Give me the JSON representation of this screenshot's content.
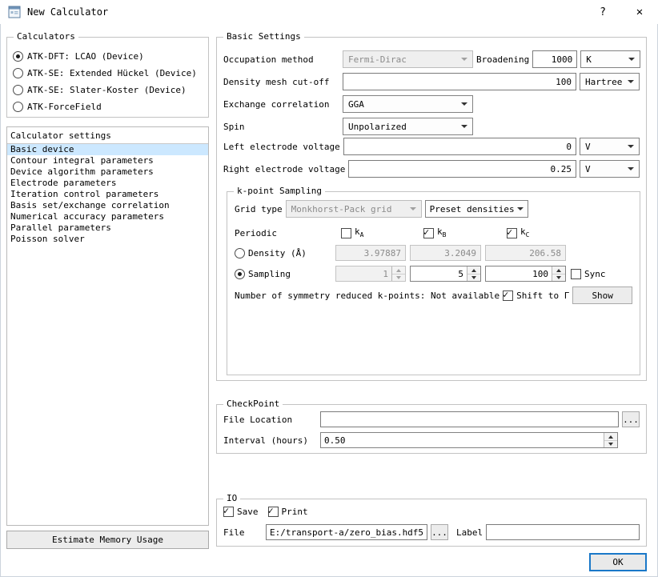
{
  "window": {
    "title": "New Calculator",
    "help": "?",
    "close": "✕"
  },
  "left": {
    "calculators": {
      "label": "Calculators",
      "options": [
        {
          "label": "ATK-DFT: LCAO (Device)",
          "selected": true
        },
        {
          "label": "ATK-SE: Extended Hückel (Device)",
          "selected": false
        },
        {
          "label": "ATK-SE: Slater-Koster (Device)",
          "selected": false
        },
        {
          "label": "ATK-ForceField",
          "selected": false
        }
      ]
    },
    "settings": {
      "header": "Calculator settings",
      "selected": "Basic device",
      "items": [
        "Basic device",
        "Contour integral parameters",
        "Device algorithm parameters",
        "Electrode parameters",
        "Iteration control parameters",
        "Basis set/exchange correlation",
        "Numerical accuracy parameters",
        "Parallel parameters",
        "Poisson solver"
      ]
    },
    "estimate_button": "Estimate Memory Usage"
  },
  "basic": {
    "label": "Basic Settings",
    "occupation_label": "Occupation method",
    "occupation_value": "Fermi-Dirac",
    "broadening_label": "Broadening",
    "broadening_value": "1000",
    "broadening_unit": "K",
    "mesh_label": "Density mesh cut-off",
    "mesh_value": "100",
    "mesh_unit": "Hartree",
    "xc_label": "Exchange correlation",
    "xc_value": "GGA",
    "spin_label": "Spin",
    "spin_value": "Unpolarized",
    "left_voltage_label": "Left electrode voltage",
    "left_voltage_value": "0",
    "left_voltage_unit": "V",
    "right_voltage_label": "Right electrode voltage",
    "right_voltage_value": "0.25",
    "right_voltage_unit": "V"
  },
  "kpoint": {
    "label": "k-point Sampling",
    "grid_type_label": "Grid type",
    "grid_type_value": "Monkhorst-Pack grid",
    "preset_button": "Preset densities",
    "periodic_label": "Periodic",
    "k": [
      {
        "base": "k",
        "sub": "A",
        "checked": false
      },
      {
        "base": "k",
        "sub": "B",
        "checked": true
      },
      {
        "base": "k",
        "sub": "C",
        "checked": true
      }
    ],
    "density_label": "Density (Å)",
    "density_selected": false,
    "density_values": [
      "3.97887",
      "3.2049",
      "206.58"
    ],
    "sampling_label": "Sampling",
    "sampling_selected": true,
    "sampling_values": [
      "1",
      "5",
      "100"
    ],
    "sync_label": "Sync",
    "sync_checked": false,
    "symmetry_text": "Number of symmetry reduced k-points: Not available",
    "shift_label": "Shift to Γ",
    "shift_checked": true,
    "show_button": "Show"
  },
  "checkpoint": {
    "label": "CheckPoint",
    "file_location_label": "File Location",
    "file_location_value": "",
    "browse_button": "...",
    "interval_label": "Interval (hours)",
    "interval_value": "0.50"
  },
  "io": {
    "label": "IO",
    "save_label": "Save",
    "save_checked": true,
    "print_label": "Print",
    "print_checked": true,
    "file_label": "File",
    "file_value": "E:/transport-a/zero_bias.hdf5",
    "browse_button": "...",
    "label_label": "Label",
    "label_value": ""
  },
  "ok_button": "OK"
}
